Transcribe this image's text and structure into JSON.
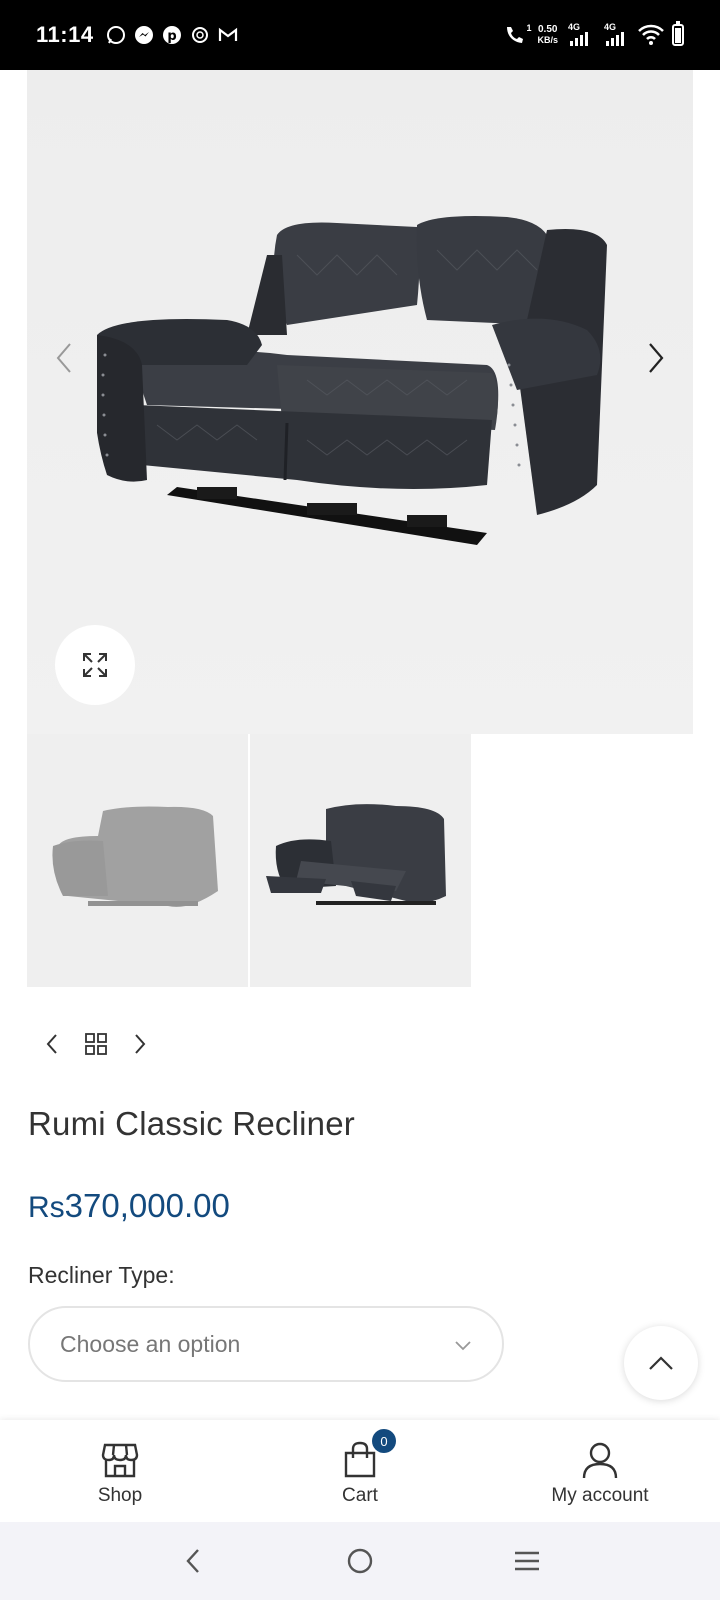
{
  "status_bar": {
    "time": "11:14",
    "net_speed_value": "0.50",
    "net_speed_unit": "KB/s",
    "sim1_label": "4G",
    "sim2_label": "4G",
    "call_label": "1"
  },
  "product": {
    "title": "Rumi Classic Recliner",
    "price_currency": "Rs",
    "price_amount": "370,000.00",
    "variation_label": "Recliner Type",
    "variation_colon": ":",
    "variation_placeholder": "Choose an option"
  },
  "toolbar": {
    "shop_label": "Shop",
    "cart_label": "Cart",
    "cart_count": "0",
    "account_label": "My account"
  },
  "colors": {
    "accent": "#134a7e",
    "statusbar": "#000000",
    "image_bg": "#efefef"
  },
  "icons": {
    "gallery_prev": "chevron-left-icon",
    "gallery_next": "chevron-right-icon",
    "zoom": "expand-icon",
    "product_grid": "grid-icon",
    "scroll_top": "chevron-up-icon",
    "shop": "store-icon",
    "cart": "shopping-bag-icon",
    "account": "user-icon"
  }
}
